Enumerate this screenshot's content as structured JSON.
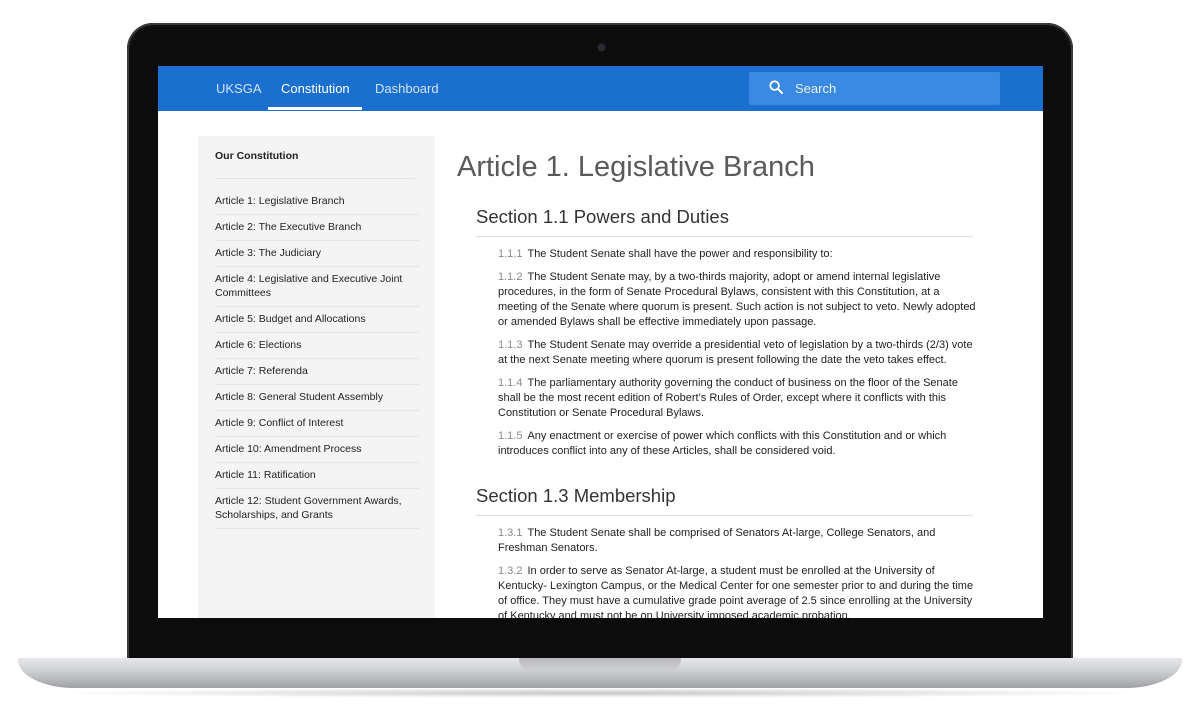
{
  "nav": {
    "brand": "UKSGA",
    "links": [
      "Constitution",
      "Dashboard"
    ],
    "search_placeholder": "Search"
  },
  "sidebar": {
    "title": "Our Constitution",
    "items": [
      "Article 1: Legislative Branch",
      "Article 2: The Executive Branch",
      "Article 3: The Judiciary",
      "Article 4: Legislative and Executive Joint Committees",
      "Article 5: Budget and Allocations",
      "Article 6: Elections",
      "Article 7: Referenda",
      "Article 8: General Student Assembly",
      "Article 9: Conflict of Interest",
      "Article 10: Amendment Process",
      "Article 11: Ratification",
      "Article 12: Student Government Awards, Scholarships, and Grants"
    ]
  },
  "article": {
    "title": "Article 1. Legislative Branch",
    "sections": [
      {
        "title": "Section 1.1 Powers and Duties",
        "clauses": [
          {
            "num": "1.1.1",
            "text": "The Student Senate shall have the power and responsibility to:"
          },
          {
            "num": "1.1.2",
            "text": "The Student Senate may, by a two-thirds majority, adopt or amend internal legislative procedures, in the form of Senate Procedural Bylaws, consistent with this Constitution, at a meeting of the Senate where quorum is present. Such action is not subject to veto. Newly adopted or amended Bylaws shall be effective immediately upon passage."
          },
          {
            "num": "1.1.3",
            "text": "The Student Senate may override a presidential veto of legislation by a two-thirds (2/3) vote at the next Senate meeting where quorum is present following the date the veto takes effect."
          },
          {
            "num": "1.1.4",
            "text": "The parliamentary authority governing the conduct of business on the floor of the Senate shall be the most recent edition of Robert’s Rules of Order, except where it conflicts with this Constitution or Senate Procedural Bylaws."
          },
          {
            "num": "1.1.5",
            "text": "Any enactment or exercise of power which conflicts with this Constitution and or which introduces conflict into any of these Articles, shall be considered void."
          }
        ]
      },
      {
        "title": "Section 1.3 Membership",
        "clauses": [
          {
            "num": "1.3.1",
            "text": "The Student Senate shall be comprised of Senators At-large, College Senators, and Freshman Senators."
          },
          {
            "num": "1.3.2",
            "text": "In order to serve as Senator At-large, a student must be enrolled at the University of Kentucky- Lexington Campus, or the Medical Center for one semester prior to and during the time of office. They must have a cumulative grade point average of 2.5 since enrolling at the University of Kentucky and must not be on University imposed academic probation."
          }
        ]
      }
    ]
  },
  "colors": {
    "nav_bg": "#1a6fcf",
    "search_bg": "#3a8ae3",
    "sidebar_bg": "#f4f4f4"
  }
}
